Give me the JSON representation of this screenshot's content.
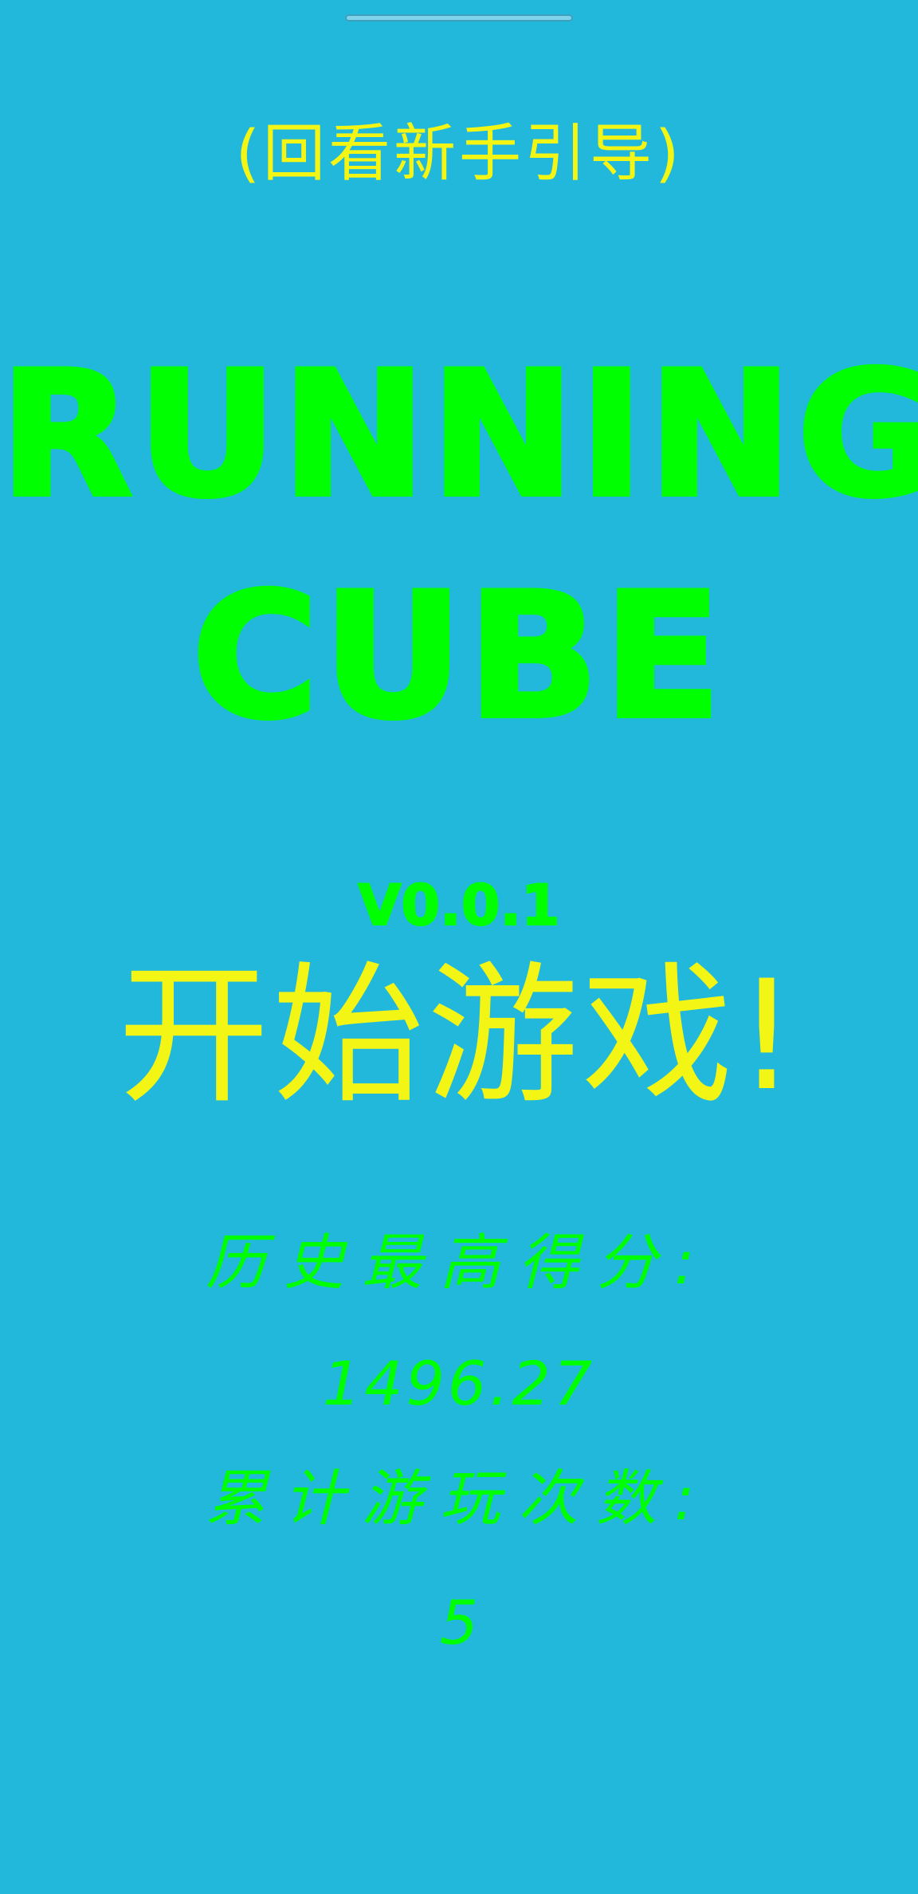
{
  "tutorial_link": "(回看新手引导)",
  "title": {
    "line1": "RUNNING",
    "line2": "CUBE"
  },
  "version": "V0.0.1",
  "start_button": "开始游戏!",
  "stats": {
    "high_score_label": "历史最高得分:",
    "high_score_value": "1496.27",
    "play_count_label": "累计游玩次数:",
    "play_count_value": "5"
  },
  "colors": {
    "background": "#22b8dc",
    "title_green": "#00ff00",
    "accent_yellow": "#f3f514"
  }
}
